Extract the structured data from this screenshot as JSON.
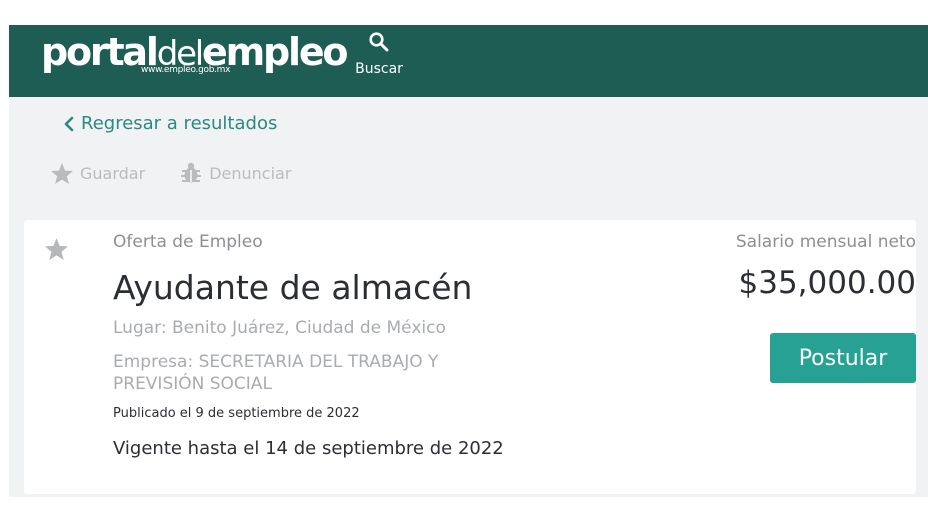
{
  "header": {
    "logo": {
      "part1": "portal",
      "part2": "del",
      "part3": "empleo",
      "url": "www.empleo.gob.mx"
    },
    "search": {
      "label": "Buscar",
      "icon": "search-icon"
    }
  },
  "nav": {
    "back_label": "Regresar a resultados",
    "back_icon": "chevron-left-icon"
  },
  "actions": {
    "save": {
      "label": "Guardar",
      "icon": "star-icon"
    },
    "report": {
      "label": "Denunciar",
      "icon": "bug-icon"
    }
  },
  "job": {
    "offer_label": "Oferta de Empleo",
    "title": "Ayudante de almacén",
    "place": "Lugar: Benito Juárez, Ciudad de México",
    "company": "Empresa: SECRETARIA DEL TRABAJO Y PREVISIÓN SOCIAL",
    "published": "Publicado el 9 de septiembre de 2022",
    "valid_until": "Vigente hasta el 14 de septiembre de 2022",
    "salary_label": "Salario mensual neto",
    "salary": "$35,000.00",
    "apply_label": "Postular"
  },
  "colors": {
    "header_bg": "#1e5d53",
    "accent": "#27a193",
    "link": "#2a8a80",
    "page_bg": "#f1f2f3"
  }
}
